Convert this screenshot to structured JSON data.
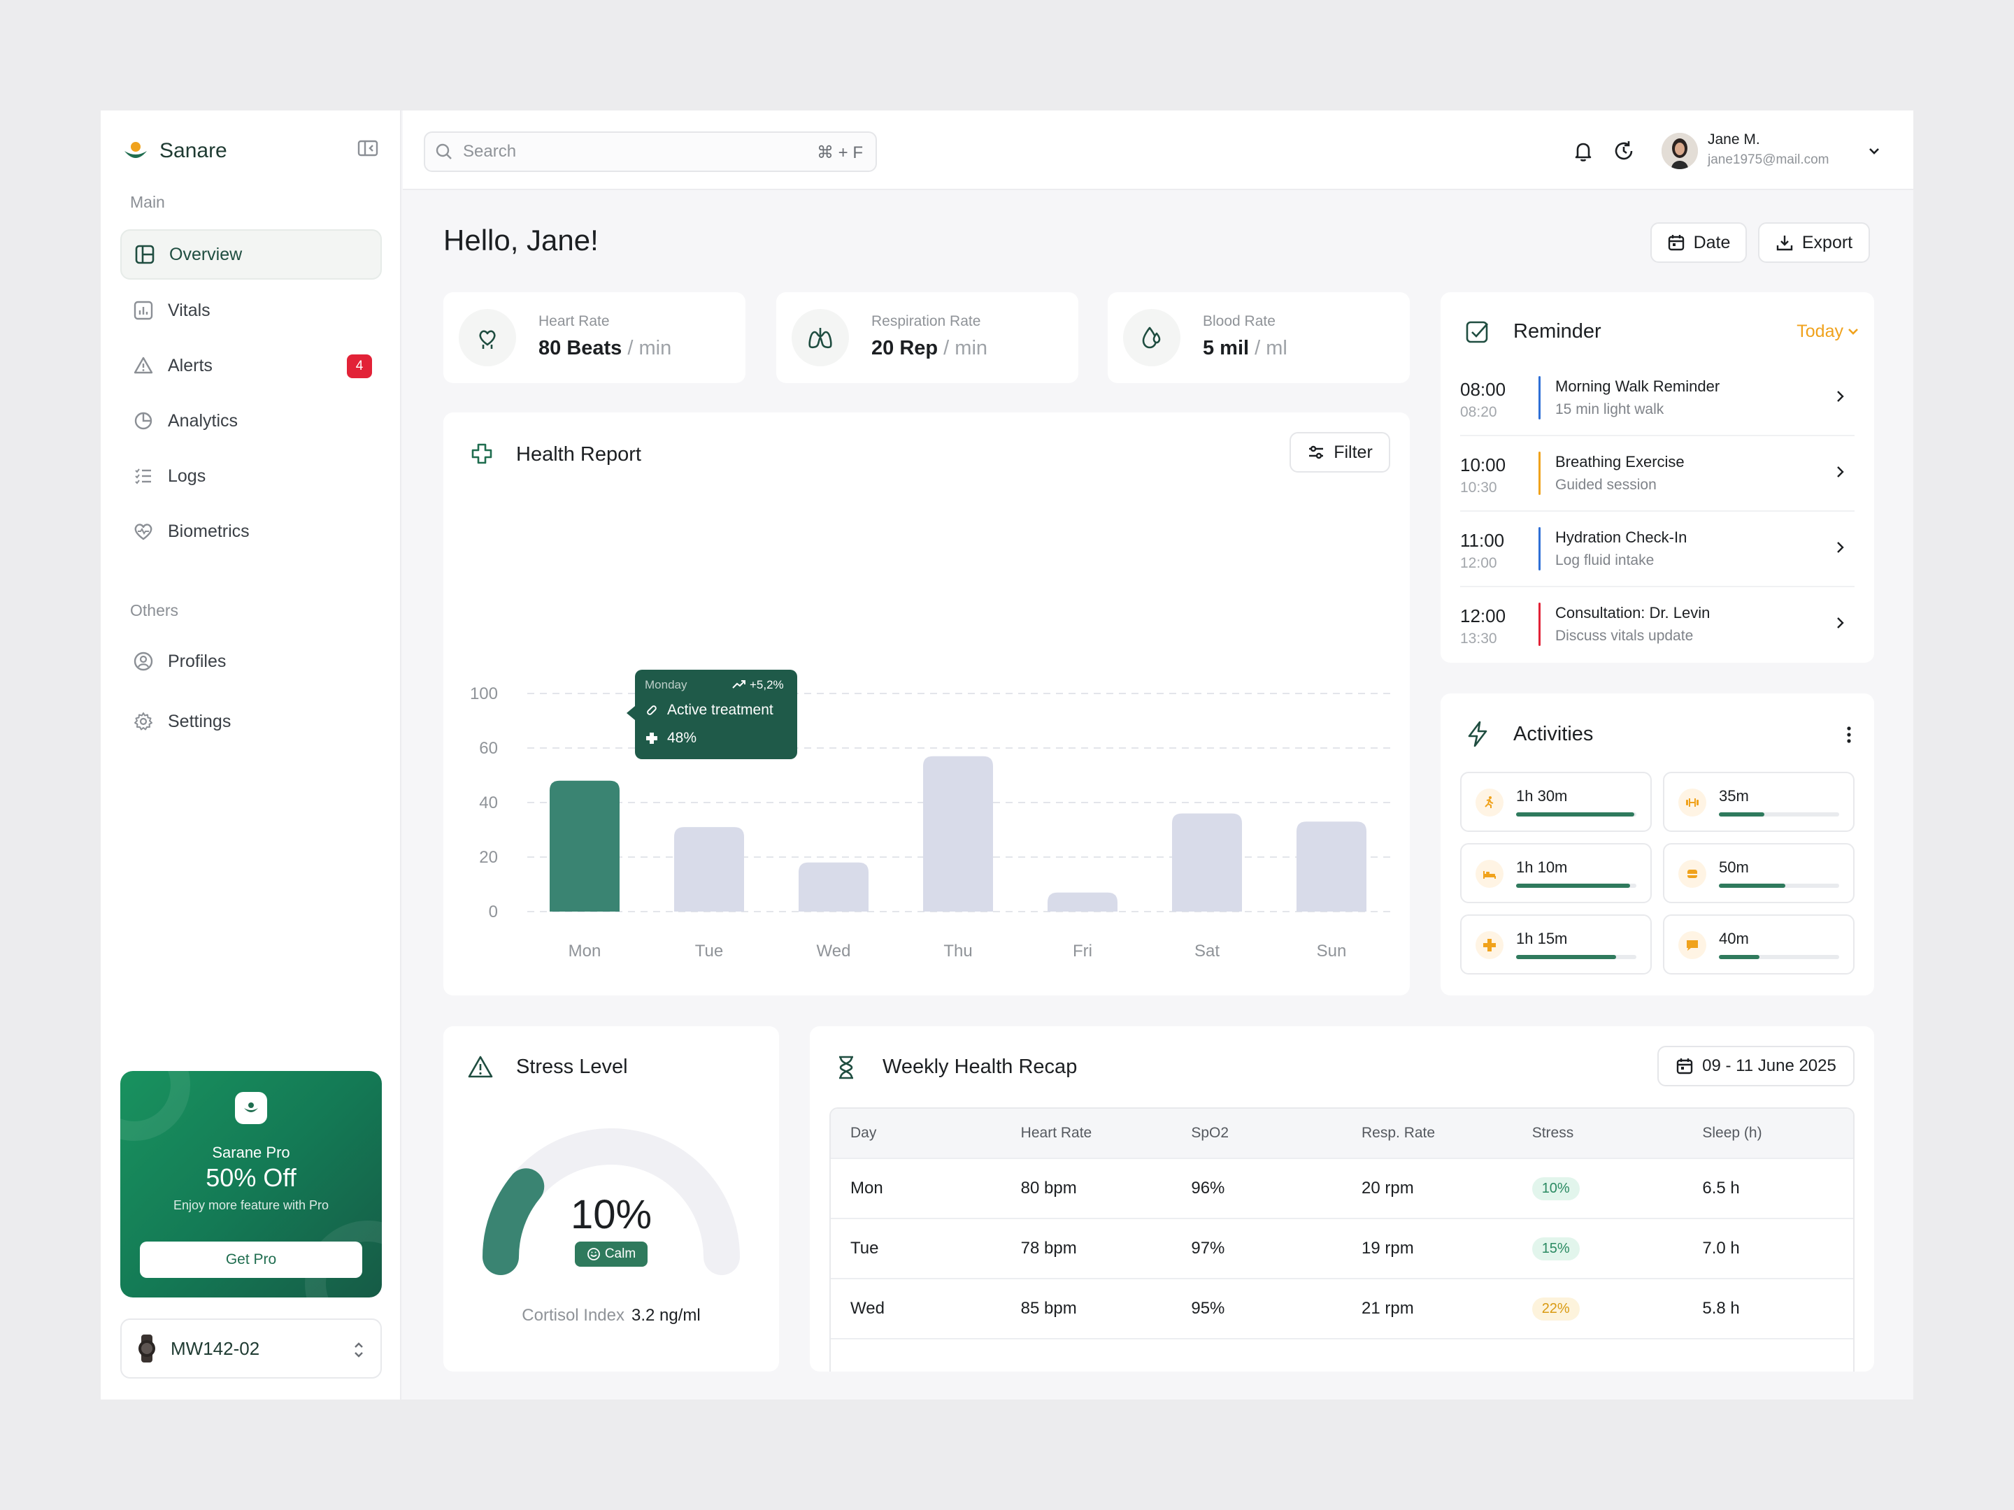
{
  "brand": {
    "name": "Sanare",
    "accent": "#2f7a5d"
  },
  "sidebar": {
    "section_main": "Main",
    "section_others": "Others",
    "items": [
      {
        "label": "Overview",
        "icon": "layout-icon"
      },
      {
        "label": "Vitals",
        "icon": "bar-chart-icon"
      },
      {
        "label": "Alerts",
        "icon": "warning-icon",
        "badge": "4"
      },
      {
        "label": "Analytics",
        "icon": "pie-chart-icon"
      },
      {
        "label": "Logs",
        "icon": "list-icon"
      },
      {
        "label": "Biometrics",
        "icon": "heart-pulse-icon"
      }
    ],
    "others": [
      {
        "label": "Profiles",
        "icon": "user-circle-icon"
      },
      {
        "label": "Settings",
        "icon": "gear-icon"
      }
    ],
    "promo": {
      "title": "Sarane Pro",
      "discount": "50% Off",
      "subtitle": "Enjoy more feature with Pro",
      "button": "Get Pro"
    },
    "device": {
      "name": "MW142-02"
    }
  },
  "header": {
    "search_placeholder": "Search",
    "search_shortcut": "⌘ + F",
    "user": {
      "name": "Jane M.",
      "email": "jane1975@mail.com"
    }
  },
  "main": {
    "greeting": "Hello, Jane!",
    "date_button": "Date",
    "export_button": "Export",
    "stats": [
      {
        "label": "Heart Rate",
        "value": "80 Beats",
        "unit": " / min"
      },
      {
        "label": "Respiration Rate",
        "value": "20 Rep",
        "unit": " / min"
      },
      {
        "label": "Blood Rate",
        "value": "5 mil",
        "unit": " / ml"
      }
    ],
    "health_report": {
      "title": "Health Report",
      "filter": "Filter",
      "tooltip": {
        "day": "Monday",
        "change": "+5,2%",
        "status": "Active treatment",
        "percent": "48%"
      }
    },
    "reminder": {
      "title": "Reminder",
      "period": "Today",
      "items": [
        {
          "time": "08:00",
          "end": "08:20",
          "title": "Morning Walk Reminder",
          "sub": "15 min light walk",
          "color": "#2f6fd6"
        },
        {
          "time": "10:00",
          "end": "10:30",
          "title": "Breathing Exercise",
          "sub": "Guided session",
          "color": "#f0a21c"
        },
        {
          "time": "11:00",
          "end": "12:00",
          "title": "Hydration Check-In",
          "sub": "Log fluid intake",
          "color": "#2f6fd6"
        },
        {
          "time": "12:00",
          "end": "13:30",
          "title": "Consultation: Dr. Levin",
          "sub": "Discuss vitals update",
          "color": "#e22237"
        }
      ]
    },
    "activities": {
      "title": "Activities",
      "items": [
        {
          "value": "1h 30m",
          "icon": "running-icon",
          "progress": 0.98
        },
        {
          "value": "35m",
          "icon": "dumbbell-icon",
          "progress": 0.38
        },
        {
          "value": "1h 10m",
          "icon": "bed-icon",
          "progress": 0.95
        },
        {
          "value": "50m",
          "icon": "food-icon",
          "progress": 0.55
        },
        {
          "value": "1h 15m",
          "icon": "medical-cross-icon",
          "progress": 0.83
        },
        {
          "value": "40m",
          "icon": "chat-icon",
          "progress": 0.34
        }
      ]
    },
    "stress": {
      "title": "Stress Level",
      "value": "10%",
      "level": 0.1,
      "badge": "Calm",
      "cortisol_label": "Cortisol Index",
      "cortisol_value": "3.2 ng/ml"
    },
    "weekly": {
      "title": "Weekly Health Recap",
      "date_range": "09 - 11 June 2025",
      "columns": [
        "Day",
        "Heart Rate",
        "SpO2",
        "Resp. Rate",
        "Stress",
        "Sleep (h)"
      ],
      "rows": [
        [
          "Mon",
          "80 bpm",
          "96%",
          "20 rpm",
          "10%",
          "6.5 h"
        ],
        [
          "Tue",
          "78 bpm",
          "97%",
          "19 rpm",
          "15%",
          "7.0 h"
        ],
        [
          "Wed",
          "85 bpm",
          "95%",
          "21 rpm",
          "22%",
          "5.8 h"
        ]
      ]
    }
  },
  "chart_data": {
    "type": "bar",
    "categories": [
      "Mon",
      "Tue",
      "Wed",
      "Thu",
      "Fri",
      "Sat",
      "Sun"
    ],
    "values": [
      48,
      31,
      18,
      57,
      7,
      36,
      33
    ],
    "y_ticks": [
      0,
      20,
      40,
      60,
      100
    ],
    "highlight_index": 0,
    "colors": {
      "highlight": "#3a8472",
      "default": "#d8dbe9"
    },
    "grid": true
  }
}
